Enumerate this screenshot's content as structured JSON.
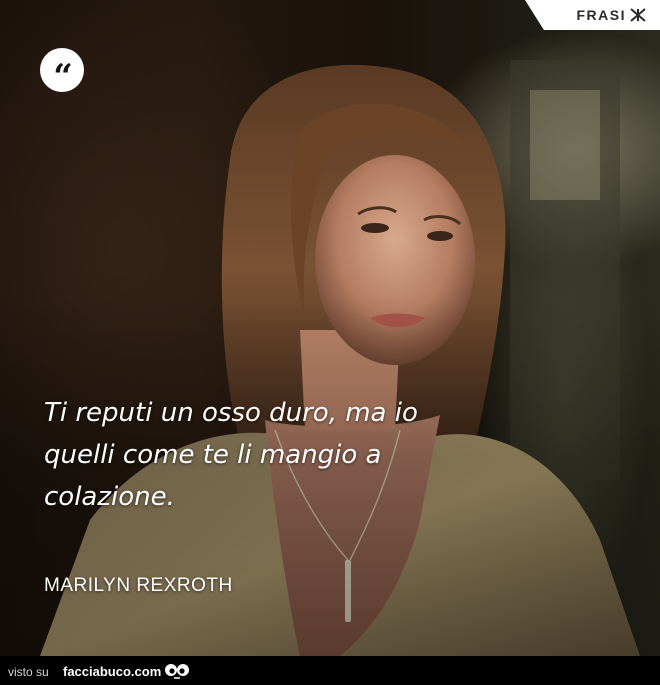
{
  "brand": {
    "name": "FRASI",
    "mark_icon": "crossed-lines-icon"
  },
  "quote": {
    "mark": "“",
    "lines": [
      "Ti reputi un osso duro, ma io",
      "quelli come te li mangio a",
      "colazione."
    ],
    "author": "MARILYN REXROTH"
  },
  "footer": {
    "prefix": "visto su",
    "site": "facciabuco.com",
    "mascot_icon": "eyes-icon"
  },
  "colors": {
    "text": "#ffffff",
    "brand_bg": "#ffffff",
    "brand_text": "#2b2b2b",
    "footer_bg": "#000000"
  }
}
